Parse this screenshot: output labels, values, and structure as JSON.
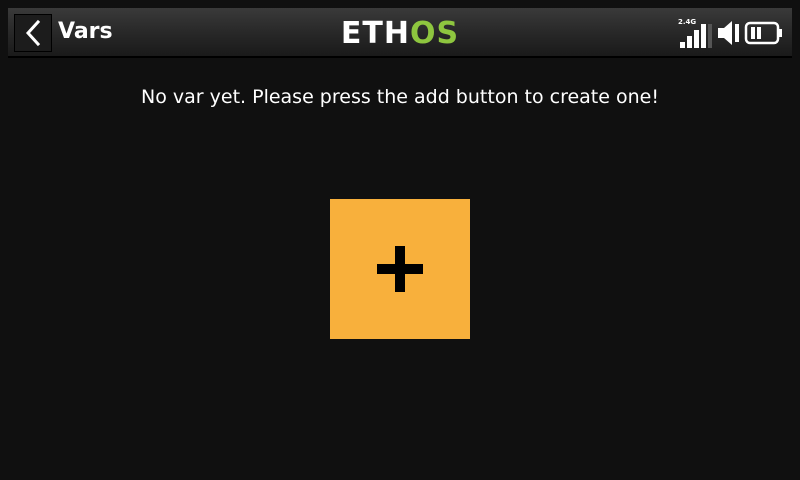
{
  "header": {
    "title": "Vars",
    "back_icon": "chevron-left-icon",
    "logo": {
      "text_white": "ETH",
      "text_green": "OS",
      "white": "#ffffff",
      "green": "#8ec63f"
    },
    "status": {
      "rf_label": "2.4G",
      "signal_icon": "signal-bars-icon",
      "speaker_icon": "speaker-icon",
      "battery_icon": "battery-icon"
    }
  },
  "main": {
    "empty_message": "No var yet. Please press the add button to create one!",
    "add_button": {
      "icon": "plus-icon",
      "color": "#f8b03c"
    }
  },
  "theme": {
    "background": "#101010"
  }
}
